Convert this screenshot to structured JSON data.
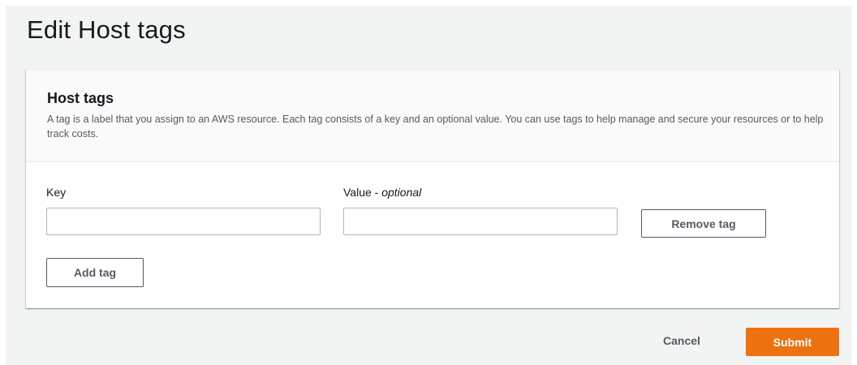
{
  "page": {
    "title": "Edit Host tags"
  },
  "tags_section": {
    "title": "Host tags",
    "description": "A tag is a label that you assign to an AWS resource. Each tag consists of a key and an optional value. You can use tags to help manage and secure your resources or to help track costs.",
    "key_label": "Key",
    "value_label": "Value - ",
    "value_label_optional": "optional",
    "key_value": "",
    "value_value": "",
    "remove_label": "Remove tag",
    "add_label": "Add tag"
  },
  "footer": {
    "cancel_label": "Cancel",
    "submit_label": "Submit"
  },
  "colors": {
    "page_background": "#f2f3f3",
    "header_background": "#fafafa",
    "primary_button": "#ec7211",
    "text": "#16191f",
    "secondary_text": "#545b64",
    "input_border": "#aab7b8"
  }
}
